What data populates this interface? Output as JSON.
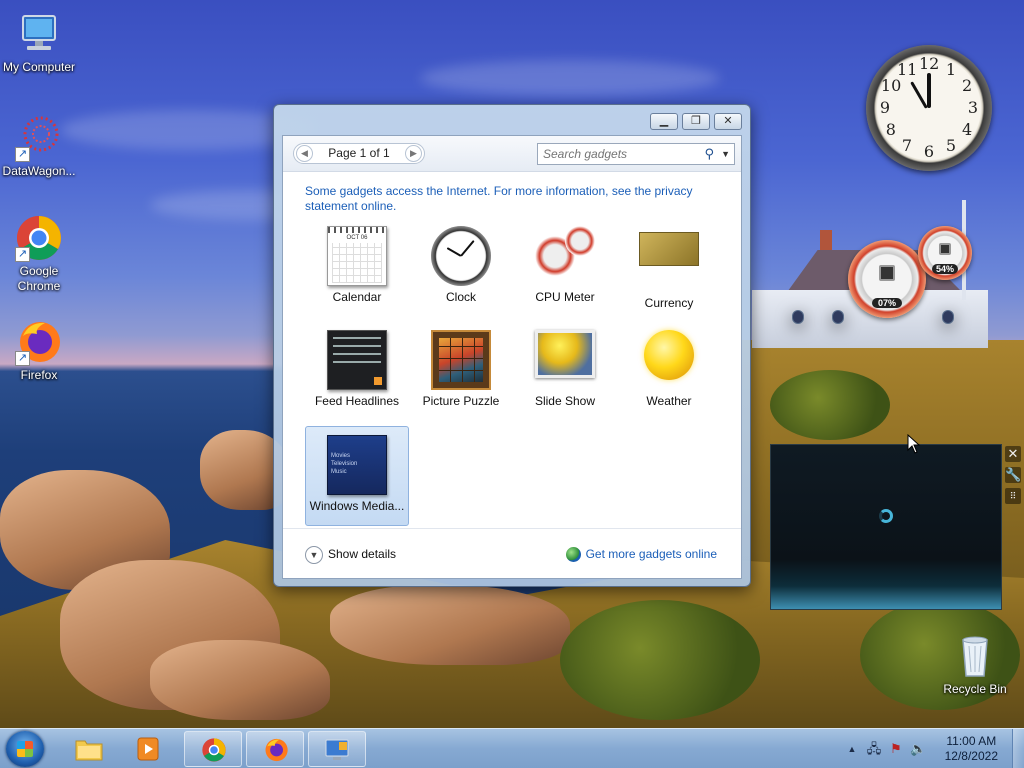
{
  "desktop": {
    "icons": [
      {
        "label": "My Computer"
      },
      {
        "label": "DataWagon..."
      },
      {
        "label": "Google Chrome"
      },
      {
        "label": "Firefox"
      },
      {
        "label": "Recycle Bin"
      }
    ]
  },
  "clock_gadget": {
    "numbers": [
      "12",
      "1",
      "2",
      "3",
      "4",
      "5",
      "6",
      "7",
      "8",
      "9",
      "10",
      "11"
    ],
    "time": "11:00"
  },
  "cpu_gadget": {
    "cpu_percent": "07%",
    "memory_percent": "54%"
  },
  "gallery": {
    "pager_label": "Page 1 of 1",
    "search_placeholder": "Search gadgets",
    "info_text": "Some gadgets access the Internet.  For more information, see the privacy statement online.",
    "gadgets": [
      {
        "label": "Calendar"
      },
      {
        "label": "Clock"
      },
      {
        "label": "CPU Meter"
      },
      {
        "label": "Currency"
      },
      {
        "label": "Feed Headlines"
      },
      {
        "label": "Picture Puzzle"
      },
      {
        "label": "Slide Show"
      },
      {
        "label": "Weather"
      },
      {
        "label": "Windows Media..."
      }
    ],
    "calendar_month": "OCT 06",
    "wmc_lines": [
      "Movies",
      "Television",
      "Music"
    ],
    "show_details": "Show details",
    "get_more": "Get more gadgets online",
    "selected_index": 8
  },
  "taskbar": {
    "time": "11:00 AM",
    "date": "12/8/2022"
  },
  "colors": {
    "link": "#1c5fb8",
    "accent": "#86a9d2"
  }
}
